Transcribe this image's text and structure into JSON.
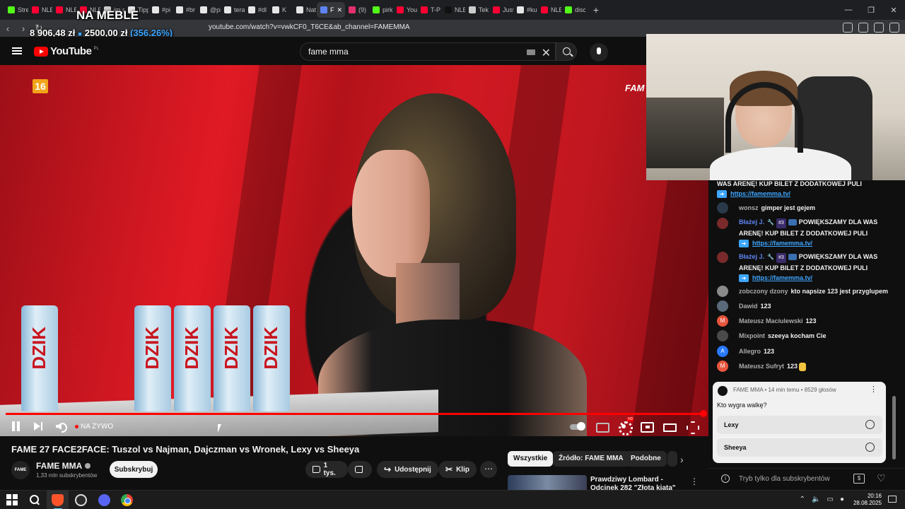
{
  "browser": {
    "tabs": [
      {
        "label": "Stre",
        "color": "#53fc18"
      },
      {
        "label": "NLE",
        "color": "#ff0033"
      },
      {
        "label": "NLE",
        "color": "#ff0033"
      },
      {
        "label": "NLE",
        "color": "#ff0033"
      },
      {
        "label": "im s",
        "color": "#cccccc"
      },
      {
        "label": "Tipp",
        "color": "#e6e6e6"
      },
      {
        "label": "#pi",
        "color": "#e6e6e6"
      },
      {
        "label": "#br",
        "color": "#e6e6e6"
      },
      {
        "label": "@pi",
        "color": "#e6e6e6"
      },
      {
        "label": "tera",
        "color": "#e6e6e6"
      },
      {
        "label": "#dl",
        "color": "#e6e6e6"
      },
      {
        "label": "K",
        "color": "#e6e6e6"
      },
      {
        "label": "Nat",
        "color": "#e6e6e6"
      },
      {
        "label": "F",
        "color": "#5e84f1",
        "active": true
      },
      {
        "label": "(9)",
        "color": "#e1306c"
      },
      {
        "label": "pirk",
        "color": "#53fc18"
      },
      {
        "label": "You",
        "color": "#ff0033"
      },
      {
        "label": "T-P",
        "color": "#ff0033"
      },
      {
        "label": "NLE",
        "color": "#111111"
      },
      {
        "label": "Tek",
        "color": "#cccccc"
      },
      {
        "label": "Just",
        "color": "#ff0033"
      },
      {
        "label": "#ku",
        "color": "#e6e6e6"
      },
      {
        "label": "NLE",
        "color": "#ff0033"
      },
      {
        "label": "disc",
        "color": "#53fc18"
      }
    ],
    "url": "youtube.com/watch?v=vwkCF0_T6CE&ab_channel=FAMEMMA"
  },
  "overlay": {
    "title": "NA MEBLE",
    "amount": "8 906,48 zł",
    "goal": "2500,00 zł",
    "percent": "(356.26%)"
  },
  "youtube": {
    "logo_text": "YouTube",
    "country": "PL",
    "search_value": "fame mma"
  },
  "video": {
    "age_rating": "16",
    "watermark": "FAM",
    "live_label": "NA ŻYWO",
    "progress": 1.0
  },
  "meta": {
    "title": "FAME 27 FACE2FACE: Tuszol vs Najman, Dajczman vs Wronek, Lexy vs Sheeya",
    "channel_avatar_text": "FAME",
    "channel": "FAME MMA",
    "subscribers": "1,33 mln subskrybentów",
    "subscribe_label": "Subskrybuj",
    "likes": "1 tys.",
    "share_label": "Udostępnij",
    "clip_label": "Klip"
  },
  "recommendations": {
    "chips": [
      "Wszystkie",
      "Źródło: FAME MMA",
      "Podobne"
    ],
    "first_title": "Prawdziwy Lombard - Odcinek 282 \"Złota kiata\""
  },
  "chat": {
    "messages": [
      {
        "text": "WAS ARENĘ! KUP BILET Z DODATKOWEJ PULI",
        "link": "https://famemma.tv/"
      },
      {
        "author": "wonsz",
        "text": "gimper jest gejem",
        "avatar": "#2a3a4a"
      },
      {
        "author": "Błażej J.",
        "badge": "#3",
        "text": "POWIĘKSZAMY DLA WAS ARENĘ! KUP BILET Z DODATKOWEJ PULI",
        "link": "https://famemma.tv/",
        "avatar": "#7a2a2a"
      },
      {
        "author": "Błażej J.",
        "badge": "#3",
        "text": "POWIĘKSZAMY DLA WAS ARENĘ! KUP BILET Z DODATKOWEJ PULI",
        "link": "https://famemma.tv/",
        "avatar": "#7a2a2a"
      },
      {
        "author": "zobczony dzony",
        "text": "kto napsize 123 jest przyglupem",
        "avatar": "#8a8a8a"
      },
      {
        "author": "Dawid",
        "text": "123",
        "avatar": "#5a6a7a"
      },
      {
        "author": "Mateusz Maciulewski",
        "text": "123",
        "avatar": "#e8553e",
        "initial": "M"
      },
      {
        "author": "Mixpoint",
        "text": "szeeya kocham Cie",
        "avatar": "#4a4a4a"
      },
      {
        "author": "Allegro",
        "text": "123",
        "avatar": "#2979ff",
        "initial": "A"
      },
      {
        "author": "Mateusz Sufryt",
        "text": "123",
        "avatar": "#e8553e",
        "initial": "M"
      }
    ],
    "poll": {
      "meta": "FAME MMA • 14 min temu • 8529 głosów",
      "question": "Kto wygra walkę?",
      "options": [
        "Lexy",
        "Sheeya"
      ]
    },
    "footer_text": "Tryb tylko dla subskrybentów"
  },
  "taskbar": {
    "time": "20:16",
    "date": "28.08.2025"
  }
}
